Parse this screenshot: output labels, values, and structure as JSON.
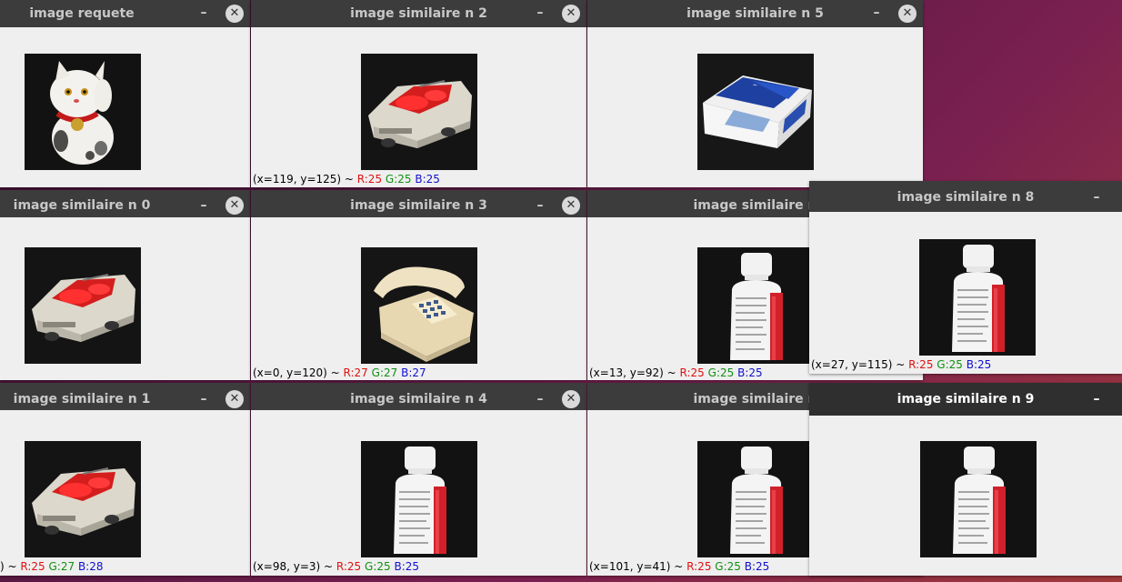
{
  "colors": {
    "titlebar": "#3c3c3c",
    "window_bg": "#efefef",
    "status_r": "#e01010",
    "status_g": "#109010",
    "status_b": "#1010d0"
  },
  "icons": {
    "minimize": "–",
    "close": "✕"
  },
  "windows": {
    "w_requete": {
      "title": "image requete"
    },
    "w_n2": {
      "title": "image similaire n 2",
      "status": {
        "coords": "(x=119, y=125) ~ ",
        "r": "R:25",
        "g": "G:25",
        "b": "B:25"
      }
    },
    "w_n5": {
      "title": "image similaire n 5"
    },
    "w_n0": {
      "title": "image similaire n 0"
    },
    "w_n3": {
      "title": "image similaire n 3",
      "status": {
        "coords": "(x=0, y=120) ~ ",
        "r": "R:27",
        "g": "G:27",
        "b": "B:27"
      }
    },
    "w_n6": {
      "title": "image similaire n",
      "status": {
        "coords": "(x=13, y=92) ~ ",
        "r": "R:25",
        "g": "G:25",
        "b": "B:25"
      }
    },
    "w_n8": {
      "title": "image similaire n 8",
      "status": {
        "coords": "(x=27, y=115) ~ ",
        "r": "R:25",
        "g": "G:25",
        "b": "B:25"
      }
    },
    "w_n1": {
      "title": "image similaire n 1",
      "status": {
        "coords": ") ~ ",
        "r": "R:25",
        "g": "G:27",
        "b": "B:28"
      }
    },
    "w_n4": {
      "title": "image similaire n 4",
      "status": {
        "coords": "(x=98, y=3) ~ ",
        "r": "R:25",
        "g": "G:25",
        "b": "B:25"
      }
    },
    "w_n7": {
      "title": "image similaire n",
      "status": {
        "coords": "(x=101, y=41) ~ ",
        "r": "R:25",
        "g": "G:25",
        "b": "B:25"
      }
    },
    "w_n9": {
      "title": "image similaire n 9"
    }
  },
  "thumbnails": {
    "cat": "lucky-cat",
    "car": "toy-car",
    "cigarettes": "cigarette-pack",
    "phone": "telephone",
    "bottle": "bottle"
  }
}
